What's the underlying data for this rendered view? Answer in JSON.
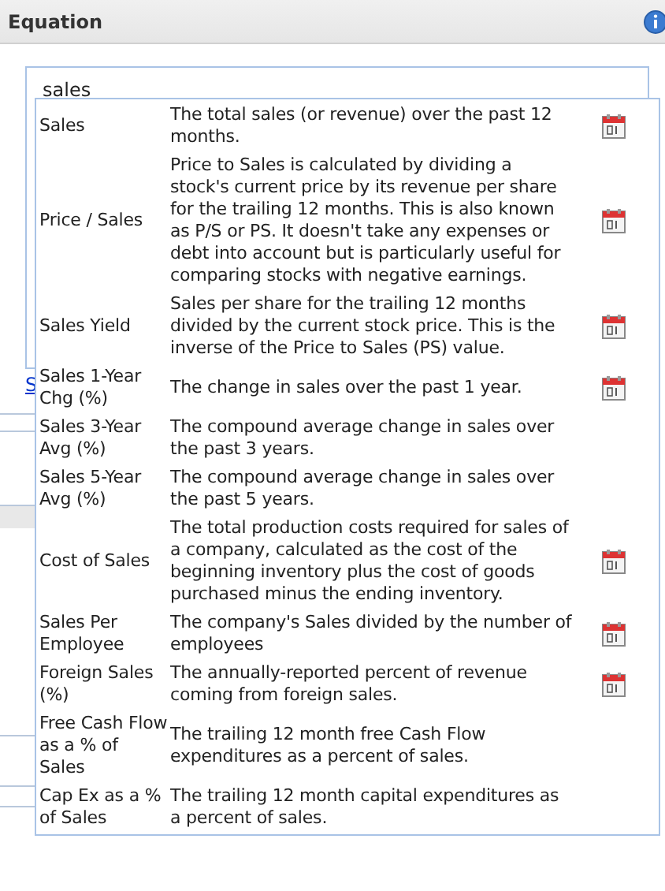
{
  "panel": {
    "title": "Equation"
  },
  "equation_field": {
    "value": "sales"
  },
  "link": "S",
  "suggestions": [
    {
      "name": "Sales",
      "description": "The total sales (or revenue) over the past 12 months.",
      "calendar": true
    },
    {
      "name": "Price / Sales",
      "description": "Price to Sales is calculated by dividing a stock's current price by its revenue per share for the trailing 12 months. This is also known as P/S or PS. It doesn't take any expenses or debt into account but is particularly useful for comparing stocks with negative earnings.",
      "calendar": true
    },
    {
      "name": "Sales Yield",
      "description": "Sales per share for the trailing 12 months divided by the current stock price. This is the inverse of the Price to Sales (PS) value.",
      "calendar": true
    },
    {
      "name": "Sales 1-Year Chg (%)",
      "description": "The change in sales over the past 1 year.",
      "calendar": true
    },
    {
      "name": "Sales 3-Year Avg (%)",
      "description": "The compound average change in sales over the past 3 years.",
      "calendar": false
    },
    {
      "name": "Sales 5-Year Avg (%)",
      "description": "The compound average change in sales over the past 5 years.",
      "calendar": false
    },
    {
      "name": "Cost of Sales",
      "description": "The total production costs required for sales of a company, calculated as the cost of the beginning inventory plus the cost of goods purchased minus the ending inventory.",
      "calendar": true
    },
    {
      "name": "Sales Per Employee",
      "description": "The company's Sales divided by the number of employees",
      "calendar": true
    },
    {
      "name": "Foreign Sales (%)",
      "description": "The annually-reported percent of revenue coming from foreign sales.",
      "calendar": true
    },
    {
      "name": "Free Cash Flow as a % of Sales",
      "description": "The trailing 12 month free Cash Flow expenditures as a percent of sales.",
      "calendar": false
    },
    {
      "name": "Cap Ex as a % of Sales",
      "description": "The trailing 12 month capital expenditures as a percent of sales.",
      "calendar": false
    }
  ]
}
